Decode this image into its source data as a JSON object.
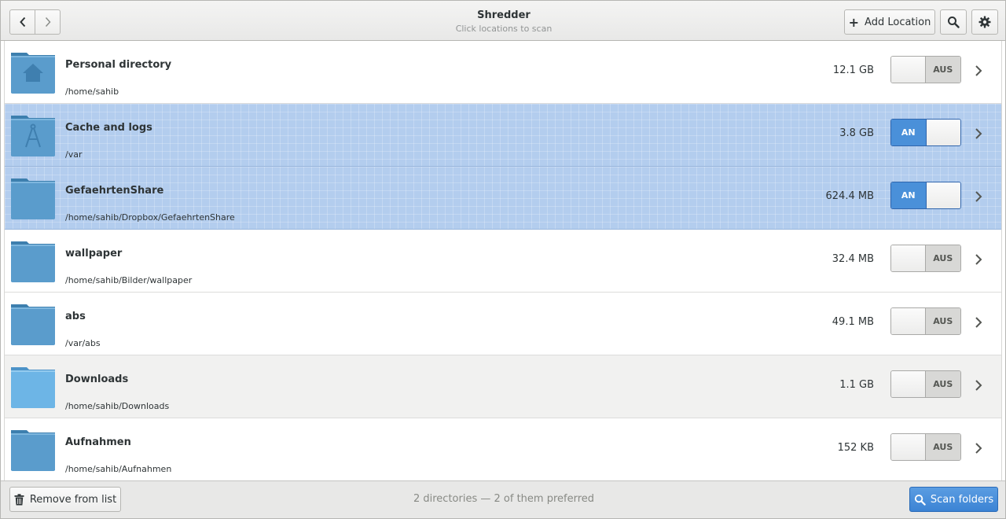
{
  "header": {
    "title": "Shredder",
    "subtitle": "Click locations to scan",
    "back_icon": "chevron-left-icon",
    "forward_icon": "chevron-right-icon",
    "add_location_label": "Add Location",
    "search_icon": "search-icon",
    "settings_icon": "gear-icon"
  },
  "locations": [
    {
      "name": "Personal directory",
      "path": "/home/sahib",
      "size": "12.1 GB",
      "toggle": "AUS",
      "on": false,
      "selected": false,
      "icon": "home-folder-icon"
    },
    {
      "name": "Cache and logs",
      "path": "/var",
      "size": "3.8 GB",
      "toggle": "AN",
      "on": true,
      "selected": true,
      "icon": "system-folder-icon"
    },
    {
      "name": "GefaehrtenShare",
      "path": "/home/sahib/Dropbox/GefaehrtenShare",
      "size": "624.4 MB",
      "toggle": "AN",
      "on": true,
      "selected": true,
      "icon": "folder-icon"
    },
    {
      "name": "wallpaper",
      "path": "/home/sahib/Bilder/wallpaper",
      "size": "32.4 MB",
      "toggle": "AUS",
      "on": false,
      "selected": false,
      "icon": "folder-icon"
    },
    {
      "name": "abs",
      "path": "/var/abs",
      "size": "49.1 MB",
      "toggle": "AUS",
      "on": false,
      "selected": false,
      "icon": "folder-icon"
    },
    {
      "name": "Downloads",
      "path": "/home/sahib/Downloads",
      "size": "1.1 GB",
      "toggle": "AUS",
      "on": false,
      "selected": false,
      "icon": "downloads-folder-icon"
    },
    {
      "name": "Aufnahmen",
      "path": "/home/sahib/Aufnahmen",
      "size": "152 KB",
      "toggle": "AUS",
      "on": false,
      "selected": false,
      "icon": "folder-icon"
    }
  ],
  "footer": {
    "remove_label": "Remove from list",
    "status": "2 directories — 2 of them preferred",
    "scan_label": "Scan folders"
  },
  "colors": {
    "accent": "#4a90d9",
    "selection": "#b3cdee",
    "folder": "#5a9ccc"
  }
}
